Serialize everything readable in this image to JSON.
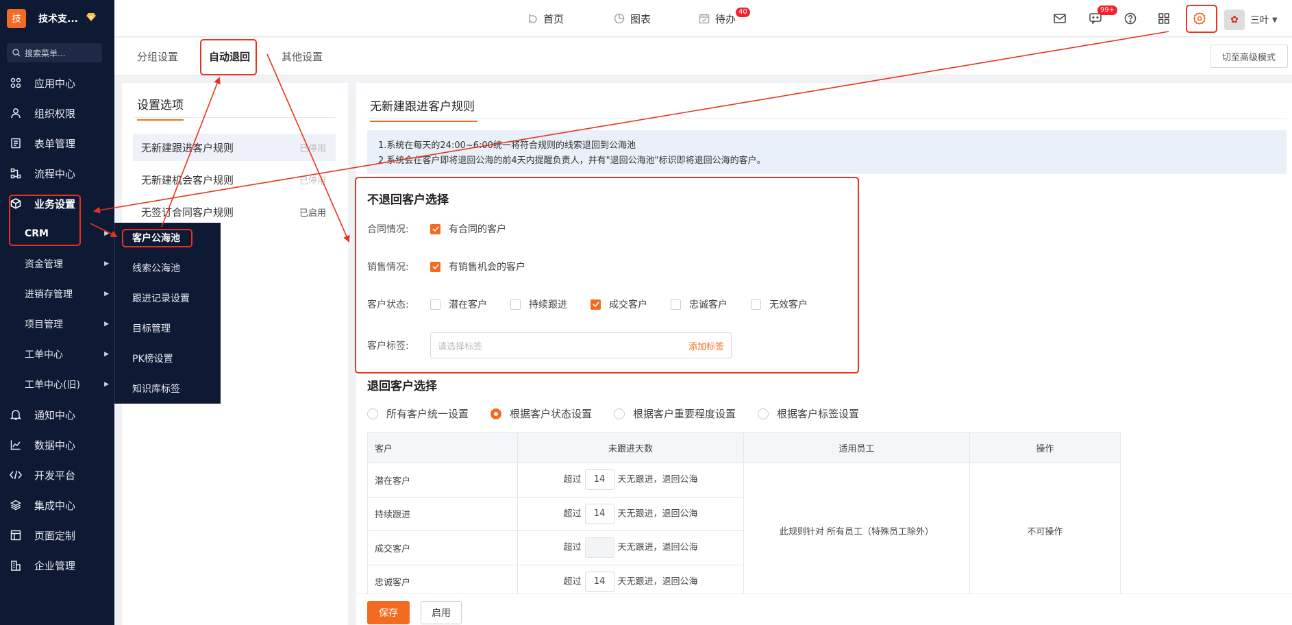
{
  "brand": {
    "logo_char": "技",
    "name": "技术支...",
    "gem_icon": "diamond-icon"
  },
  "sidebar": {
    "search_placeholder": "搜索菜单...",
    "top_items": [
      {
        "label": "应用中心",
        "icon": "apps-icon"
      },
      {
        "label": "组织权限",
        "icon": "user-icon"
      },
      {
        "label": "表单管理",
        "icon": "form-icon"
      },
      {
        "label": "流程中心",
        "icon": "flow-icon"
      },
      {
        "label": "业务设置",
        "icon": "cube-icon"
      }
    ],
    "sub_items": [
      {
        "label": "CRM"
      },
      {
        "label": "资金管理"
      },
      {
        "label": "进销存管理"
      },
      {
        "label": "项目管理"
      },
      {
        "label": "工单中心"
      },
      {
        "label": "工单中心(旧)"
      }
    ],
    "bottom_items": [
      {
        "label": "通知中心",
        "icon": "bell-icon"
      },
      {
        "label": "数据中心",
        "icon": "chart-icon"
      },
      {
        "label": "开发平台",
        "icon": "code-icon"
      },
      {
        "label": "集成中心",
        "icon": "layers-icon"
      },
      {
        "label": "页面定制",
        "icon": "layout-icon"
      },
      {
        "label": "企业管理",
        "icon": "building-icon"
      }
    ]
  },
  "flyout": {
    "items": [
      "客户公海池",
      "线索公海池",
      "跟进记录设置",
      "目标管理",
      "PK榜设置",
      "知识库标签"
    ]
  },
  "topnav": {
    "home": "首页",
    "charts": "图表",
    "todo": "待办",
    "todo_badge": "40",
    "chat_badge": "99+",
    "user_name": "三叶"
  },
  "tabs": {
    "group": "分组设置",
    "auto_return": "自动退回",
    "other": "其他设置",
    "advanced_button": "切至高级模式"
  },
  "left_panel": {
    "title": "设置选项",
    "rules": [
      {
        "name": "无新建跟进客户规则",
        "status": "已停用"
      },
      {
        "name": "无新建机会客户规则",
        "status": "已停用"
      },
      {
        "name": "无签订合同客户规则",
        "status": "已启用"
      }
    ]
  },
  "main": {
    "title": "无新建跟进客户规则",
    "notice": [
      "1.系统在每天的24:00~6:00统一将符合规则的线索退回到公海池",
      "2.系统会在客户即将退回公海的前4天内提醒负责人，并有\"退回公海池\"标识即将退回公海的客户。"
    ],
    "exclude_section": {
      "title": "不退回客户选择",
      "contract_label": "合同情况:",
      "contract_option": "有合同的客户",
      "sales_label": "销售情况:",
      "sales_option": "有销售机会的客户",
      "status_label": "客户状态:",
      "statuses": [
        {
          "label": "潜在客户",
          "checked": false
        },
        {
          "label": "持续跟进",
          "checked": false
        },
        {
          "label": "成交客户",
          "checked": true
        },
        {
          "label": "忠诚客户",
          "checked": false
        },
        {
          "label": "无效客户",
          "checked": false
        }
      ],
      "tag_label": "客户标签:",
      "tag_placeholder": "请选择标签",
      "tag_add": "添加标签"
    },
    "return_section": {
      "title": "退回客户选择",
      "modes": [
        {
          "label": "所有客户统一设置",
          "selected": false
        },
        {
          "label": "根据客户状态设置",
          "selected": true
        },
        {
          "label": "根据客户重要程度设置",
          "selected": false
        },
        {
          "label": "根据客户标签设置",
          "selected": false
        }
      ],
      "table": {
        "headers": [
          "客户",
          "未跟进天数",
          "适用员工",
          "操作"
        ],
        "prefix": "超过",
        "suffix": "天无跟进，退回公海",
        "rows": [
          {
            "customer": "潜在客户",
            "days": "14"
          },
          {
            "customer": "持续跟进",
            "days": "14"
          },
          {
            "customer": "成交客户",
            "days": ""
          },
          {
            "customer": "忠诚客户",
            "days": "14"
          }
        ],
        "staff": "此规则针对 所有员工（特殊员工除外）",
        "action": "不可操作"
      }
    }
  },
  "footer": {
    "save": "保存",
    "enable": "启用"
  },
  "colors": {
    "accent": "#f26b21",
    "sidebar_bg": "#0e1a33",
    "highlight": "#e8321e"
  }
}
